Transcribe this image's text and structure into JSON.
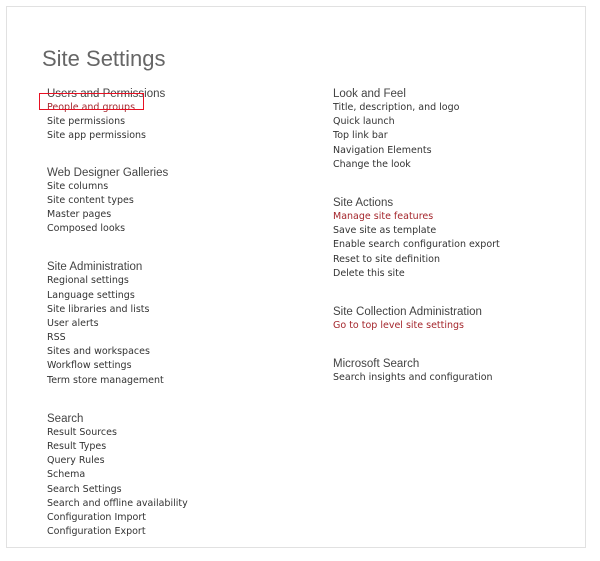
{
  "page": {
    "title": "Site Settings"
  },
  "colors": {
    "accent_link": "#a4262c",
    "highlight": "#e81123",
    "heading": "#444444",
    "link": "#333333"
  },
  "left_column": [
    {
      "title": "Users and Permissions",
      "items": [
        {
          "label": "People and groups",
          "accent": true
        },
        {
          "label": "Site permissions",
          "accent": false
        },
        {
          "label": "Site app permissions",
          "accent": false
        }
      ]
    },
    {
      "title": "Web Designer Galleries",
      "items": [
        {
          "label": "Site columns",
          "accent": false
        },
        {
          "label": "Site content types",
          "accent": false
        },
        {
          "label": "Master pages",
          "accent": false
        },
        {
          "label": "Composed looks",
          "accent": false
        }
      ]
    },
    {
      "title": "Site Administration",
      "items": [
        {
          "label": "Regional settings",
          "accent": false
        },
        {
          "label": "Language settings",
          "accent": false
        },
        {
          "label": "Site libraries and lists",
          "accent": false
        },
        {
          "label": "User alerts",
          "accent": false
        },
        {
          "label": "RSS",
          "accent": false
        },
        {
          "label": "Sites and workspaces",
          "accent": false
        },
        {
          "label": "Workflow settings",
          "accent": false
        },
        {
          "label": "Term store management",
          "accent": false
        }
      ]
    },
    {
      "title": "Search",
      "items": [
        {
          "label": "Result Sources",
          "accent": false
        },
        {
          "label": "Result Types",
          "accent": false
        },
        {
          "label": "Query Rules",
          "accent": false
        },
        {
          "label": "Schema",
          "accent": false
        },
        {
          "label": "Search Settings",
          "accent": false
        },
        {
          "label": "Search and offline availability",
          "accent": false
        },
        {
          "label": "Configuration Import",
          "accent": false
        },
        {
          "label": "Configuration Export",
          "accent": false
        }
      ]
    }
  ],
  "right_column": [
    {
      "title": "Look and Feel",
      "items": [
        {
          "label": "Title, description, and logo",
          "accent": false
        },
        {
          "label": "Quick launch",
          "accent": false
        },
        {
          "label": "Top link bar",
          "accent": false
        },
        {
          "label": "Navigation Elements",
          "accent": false
        },
        {
          "label": "Change the look",
          "accent": false
        }
      ]
    },
    {
      "title": "Site Actions",
      "items": [
        {
          "label": "Manage site features",
          "accent": true
        },
        {
          "label": "Save site as template",
          "accent": false
        },
        {
          "label": "Enable search configuration export",
          "accent": false
        },
        {
          "label": "Reset to site definition",
          "accent": false
        },
        {
          "label": "Delete this site",
          "accent": false
        }
      ]
    },
    {
      "title": "Site Collection Administration",
      "items": [
        {
          "label": "Go to top level site settings",
          "accent": true
        }
      ]
    },
    {
      "title": "Microsoft Search",
      "items": [
        {
          "label": "Search insights and configuration",
          "accent": false
        }
      ]
    }
  ]
}
